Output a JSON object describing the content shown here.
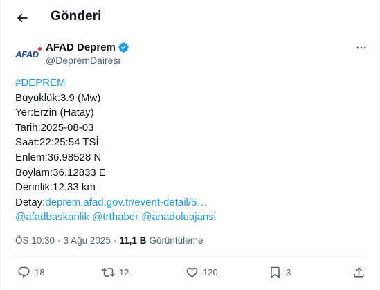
{
  "header": {
    "title": "Gönderi",
    "back_icon": "arrow-left-icon"
  },
  "author": {
    "logo_text": "AFAD",
    "name": "AFAD Deprem",
    "handle": "@DepremDairesi",
    "verified_color": "#1d9bf0"
  },
  "post": {
    "hashtag": "#DEPREM",
    "magnitude": "Büyüklük:3.9 (Mw)",
    "place": "Yer:Erzin (Hatay)",
    "date": "Tarih:2025-08-03",
    "time": "Saat:22:25:54 TSİ",
    "lat": "Enlem:36.98528 N",
    "lon": "Boylam:36.12833 E",
    "depth": "Derinlik:12.33 km",
    "detail_label": "Detay:",
    "detail_link": "deprem.afad.gov.tr/event-detail/5…",
    "mentions": [
      "@afadbaskanlik",
      "@trthaber",
      "@anadoluajansi"
    ]
  },
  "meta": {
    "time": "ÖS 10:30",
    "separator": "·",
    "date": "3 Ağu 2025",
    "views_count": "11,1 B",
    "views_label": "Görüntüleme"
  },
  "actions": {
    "replies": "18",
    "reposts": "12",
    "likes": "120",
    "bookmarks": "3"
  },
  "colors": {
    "link": "#1d9bf0",
    "muted": "#536471",
    "text": "#0f1419"
  }
}
